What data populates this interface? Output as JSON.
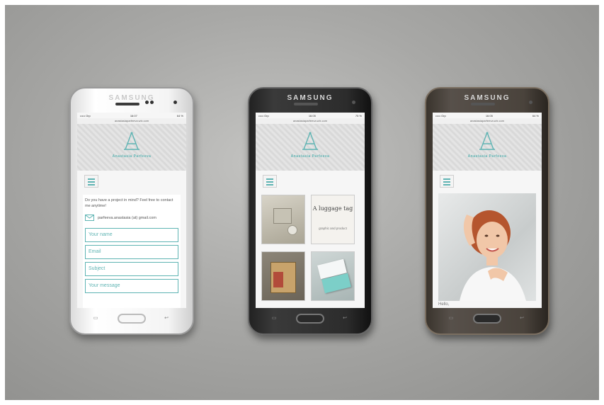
{
  "phones": [
    {
      "brand": "SAMSUNG",
      "carrier": "••••• Orp",
      "time": "16:07",
      "battery": "64 %",
      "url": "anastasiaparfeeva.wix.com",
      "site_name": "Anastasia Parfeeva",
      "contact_text": "Do you have a project in mind? Feel free to contact me anytime!",
      "email": "parfeeva.anastasia (at) gmail.com",
      "fields": [
        "Your name",
        "Email",
        "Subject",
        "Your message"
      ]
    },
    {
      "brand": "SAMSUNG",
      "carrier": "••••• Orp",
      "time": "16:05",
      "battery": "75 %",
      "url": "anastasiaparfeeva.wix.com",
      "site_name": "Anastasia Parfeeva",
      "tiles": [
        {
          "name": "product-photo-tile"
        },
        {
          "name": "luggage-tag-tile",
          "title": "A luggage tag",
          "subtitle": "graphic and product"
        },
        {
          "name": "furniture-tile"
        },
        {
          "name": "business-cards-tile"
        }
      ]
    },
    {
      "brand": "SAMSUNG",
      "carrier": "••••• Orp",
      "time": "16:05",
      "battery": "64 %",
      "url": "anastasiaparfeeva.wix.com",
      "site_name": "Anastasia Parfeeva",
      "greeting": "Hello,"
    }
  ],
  "colors": {
    "accent": "#5fb4b3"
  },
  "icons": [
    "menu-icon",
    "envelope-icon",
    "logo-icon",
    "home-button",
    "back-key-icon",
    "recent-apps-icon"
  ]
}
